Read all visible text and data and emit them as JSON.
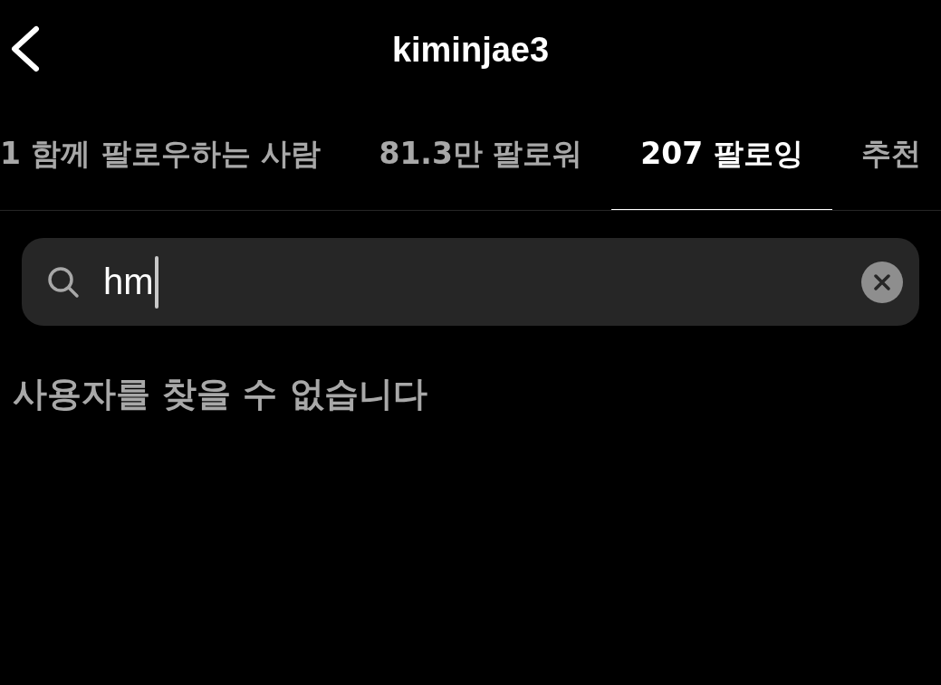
{
  "header": {
    "title": "kiminjae3"
  },
  "tabs": [
    {
      "label": "1 함께 팔로우하는 사람",
      "selected": false
    },
    {
      "label": "81.3만 팔로워",
      "selected": false
    },
    {
      "label": "207 팔로잉",
      "selected": true
    },
    {
      "label": "추천",
      "selected": false
    }
  ],
  "search": {
    "value": "hm"
  },
  "message": "사용자를 찾을 수 없습니다"
}
